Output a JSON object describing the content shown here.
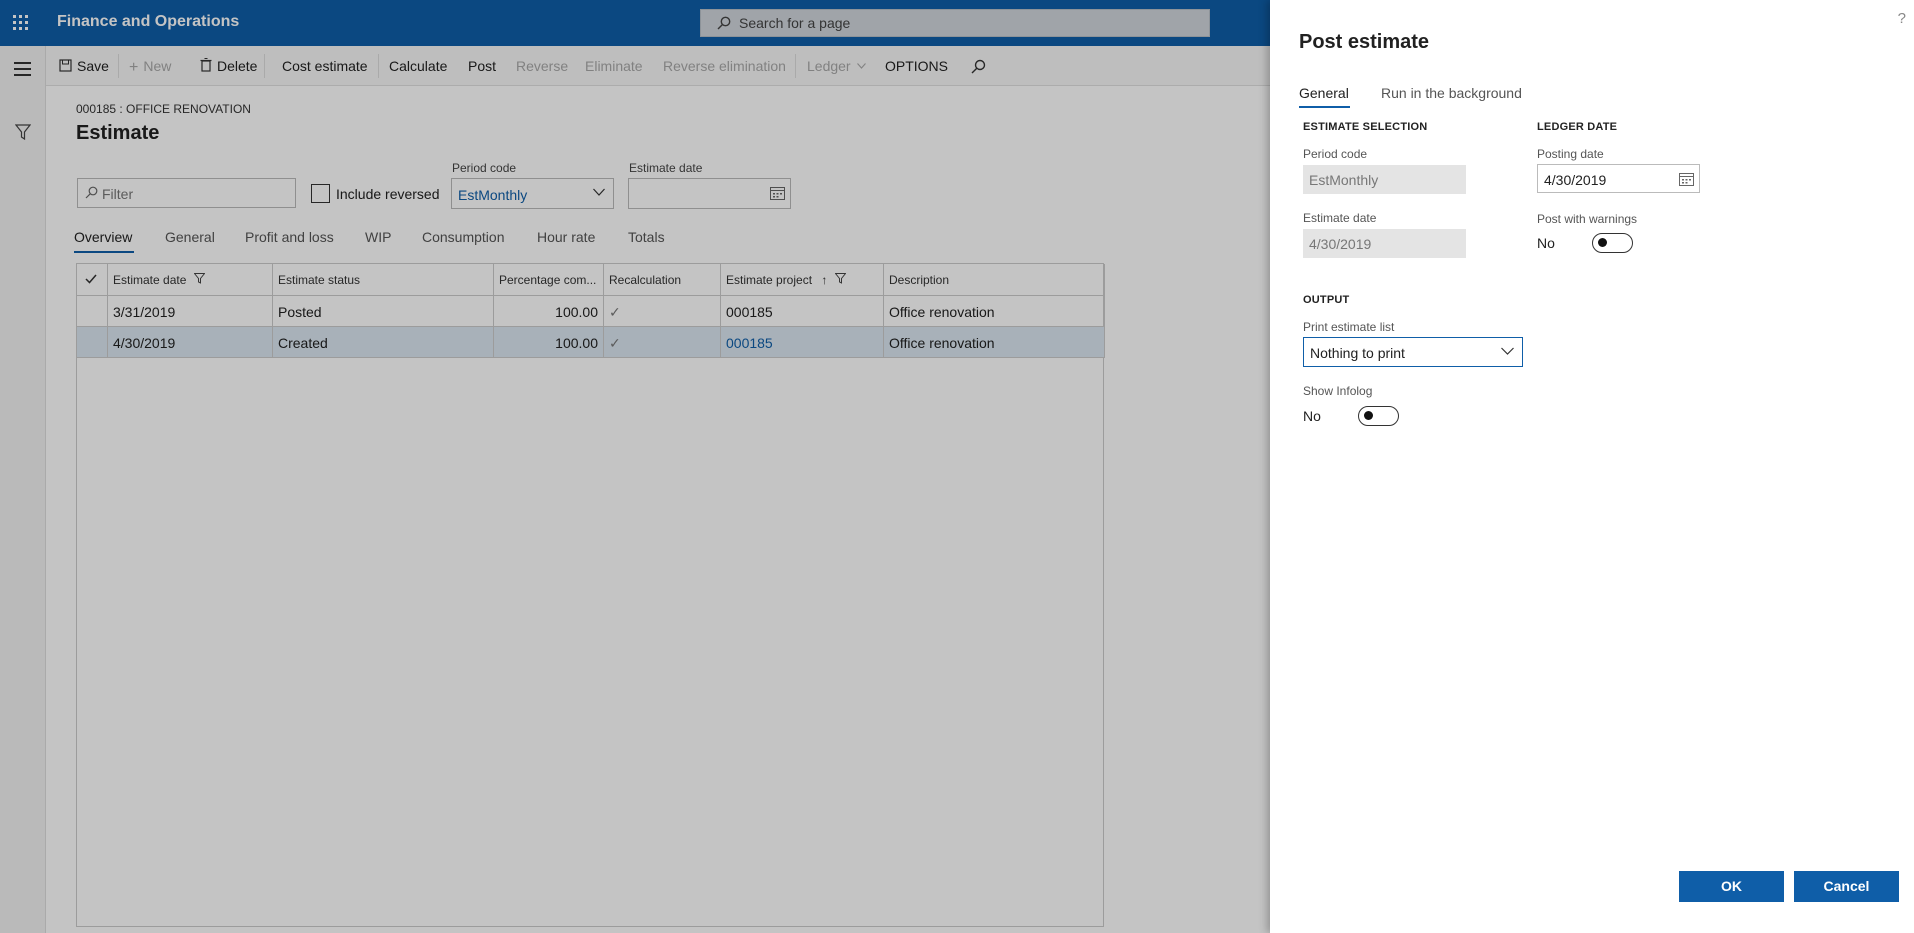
{
  "app": {
    "title": "Finance and Operations",
    "search_placeholder": "Search for a page"
  },
  "actions": {
    "save": "Save",
    "new": "New",
    "delete": "Delete",
    "cost_estimate": "Cost estimate",
    "calculate": "Calculate",
    "post": "Post",
    "reverse": "Reverse",
    "eliminate": "Eliminate",
    "reverse_elimination": "Reverse elimination",
    "ledger": "Ledger",
    "options": "OPTIONS"
  },
  "page": {
    "breadcrumb": "000185 : OFFICE RENOVATION",
    "title": "Estimate",
    "filter_placeholder": "Filter",
    "include_reversed": "Include reversed",
    "period_code_label": "Period code",
    "period_code_value": "EstMonthly",
    "estimate_date_label": "Estimate date",
    "tabs": [
      "Overview",
      "General",
      "Profit and loss",
      "WIP",
      "Consumption",
      "Hour rate",
      "Totals"
    ]
  },
  "grid": {
    "columns": [
      "Estimate date",
      "Estimate status",
      "Percentage com...",
      "Recalculation",
      "Estimate project",
      "Description"
    ],
    "rows": [
      {
        "date": "3/31/2019",
        "status": "Posted",
        "percentage": "100.00",
        "recalc": "✓",
        "project": "000185",
        "description": "Office renovation"
      },
      {
        "date": "4/30/2019",
        "status": "Created",
        "percentage": "100.00",
        "recalc": "✓",
        "project": "000185",
        "description": "Office renovation"
      }
    ]
  },
  "dialog": {
    "title": "Post estimate",
    "help": "?",
    "tabs": [
      "General",
      "Run in the background"
    ],
    "estimate_selection": "ESTIMATE SELECTION",
    "period_code_label": "Period code",
    "period_code_value": "EstMonthly",
    "estimate_date_label": "Estimate date",
    "estimate_date_value": "4/30/2019",
    "ledger_date": "LEDGER DATE",
    "posting_date_label": "Posting date",
    "posting_date_value": "4/30/2019",
    "post_with_warnings_label": "Post with warnings",
    "post_with_warnings_value": "No",
    "output": "OUTPUT",
    "print_list_label": "Print estimate list",
    "print_list_value": "Nothing to print",
    "show_infolog_label": "Show Infolog",
    "show_infolog_value": "No",
    "ok": "OK",
    "cancel": "Cancel"
  },
  "colors": {
    "accent": "#0f5ea8",
    "selected_row": "#dbe7f1"
  }
}
